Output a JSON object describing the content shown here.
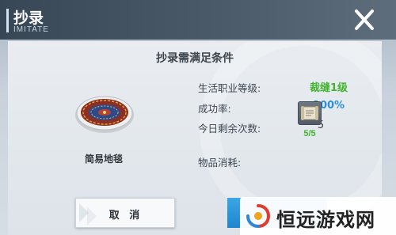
{
  "header": {
    "title": "抄录",
    "subtitle": "IMITATE"
  },
  "dialog": {
    "title": "抄录需满足条件",
    "item": {
      "name": "简易地毯",
      "icon": "rug-icon"
    },
    "requirements": {
      "profession_label": "生活职业等级:",
      "profession_value": "裁缝1级",
      "success_label": "成功率:",
      "success_value": "100%",
      "remaining_label": "今日剩余次数:",
      "remaining_value": "5",
      "materials_label": "物品消耗:",
      "material_icon": "scroll-icon",
      "material_count": "5/5"
    },
    "buttons": {
      "cancel_label": "取 消"
    }
  },
  "watermark": {
    "text": "恒远游戏网"
  },
  "colors": {
    "green": "#43b430",
    "blue": "#2f8fd6",
    "header": "#3f4e5d",
    "confirm": "#2a95dc"
  }
}
